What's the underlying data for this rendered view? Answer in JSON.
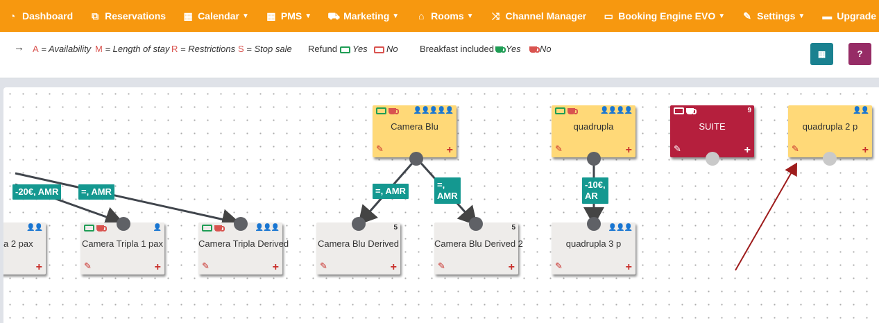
{
  "nav": {
    "items": [
      {
        "label": "Dashboard",
        "icon": "dashboard-icon",
        "chevron": false
      },
      {
        "label": "Reservations",
        "icon": "reservations-icon",
        "chevron": false
      },
      {
        "label": "Calendar",
        "icon": "calendar-icon",
        "chevron": true
      },
      {
        "label": "PMS",
        "icon": "pms-grid-icon",
        "chevron": true
      },
      {
        "label": "Marketing",
        "icon": "cart-icon",
        "chevron": true
      },
      {
        "label": "Rooms",
        "icon": "home-icon",
        "chevron": true
      },
      {
        "label": "Channel Manager",
        "icon": "shuffle-icon",
        "chevron": false
      },
      {
        "label": "Booking Engine EVO",
        "icon": "monitor-icon",
        "chevron": true
      },
      {
        "label": "Settings",
        "icon": "wrench-icon",
        "chevron": true
      },
      {
        "label": "Upgrade",
        "icon": "credit-card-icon",
        "chevron": true
      }
    ]
  },
  "legend": {
    "arrow": "→",
    "a_key": "A",
    "a_text": " = Availability",
    "m_key": "M",
    "m_text": " = Length of stay",
    "r_key": "R",
    "r_text": " = Restrictions",
    "s_key": "S",
    "s_text": " = Stop sale",
    "refund_label": "Refund",
    "refund_yes": "Yes",
    "refund_no": "No",
    "breakfast_label": "Breakfast included",
    "breakfast_yes": "Yes",
    "breakfast_no": "No",
    "colors": {
      "yes": "#1f9d55",
      "no": "#d9534f"
    }
  },
  "buttons": {
    "layout_icon": "grid-icon",
    "help_label": "?",
    "layout_color": "#1a8190",
    "help_color": "#962c66"
  },
  "nodes": {
    "camera_blu": {
      "title": "Camera Blu",
      "occupancy": "👤👤👤👤👤"
    },
    "quadrupla": {
      "title": "quadrupla",
      "occupancy": "👤👤👤👤"
    },
    "suite": {
      "title": "SUITE",
      "occupancy": "9"
    },
    "quadrupla_2p": {
      "title": "quadrupla 2 p",
      "occupancy": "👤👤"
    },
    "tripla_2pax": {
      "title": "a 2 pax",
      "occupancy": "👤👤"
    },
    "tripla_1pax": {
      "title": "Camera Tripla 1 pax",
      "occupancy": "👤"
    },
    "tripla_derived": {
      "title": "Camera Tripla Derived",
      "occupancy": "👤👤👤"
    },
    "blu_derived": {
      "title": "Camera Blu Derived",
      "occupancy": "5"
    },
    "blu_derived_2": {
      "title": "Camera Blu Derived 2",
      "occupancy": "5"
    },
    "quadrupla_3p": {
      "title": "quadrupla 3 p",
      "occupancy": "👤👤👤"
    }
  },
  "edges": {
    "l1": "-20€, AMR",
    "l2": "=, AMR",
    "l3": "=, AMR",
    "l4a": "=,",
    "l4b": "AMR",
    "l5a": "-10€,",
    "l5b": "AR"
  }
}
